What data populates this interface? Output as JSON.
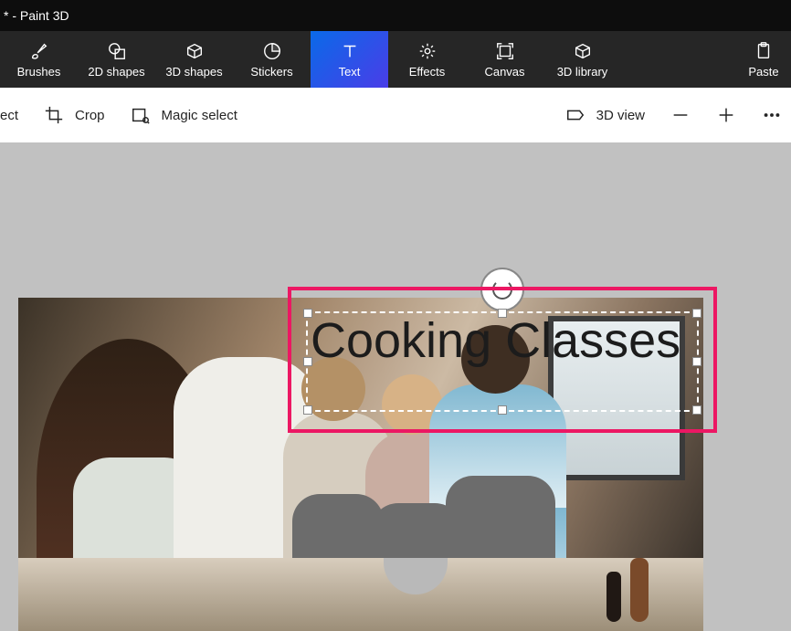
{
  "window": {
    "title": "* - Paint 3D"
  },
  "toolbar": {
    "brushes": "Brushes",
    "shapes2d": "2D shapes",
    "shapes3d": "3D shapes",
    "stickers": "Stickers",
    "text": "Text",
    "effects": "Effects",
    "canvas": "Canvas",
    "library3d": "3D library",
    "paste": "Paste"
  },
  "subtoolbar": {
    "select": "ect",
    "crop": "Crop",
    "magic_select": "Magic select",
    "view3d": "3D view"
  },
  "text_object": {
    "content": "Cooking Classes"
  }
}
